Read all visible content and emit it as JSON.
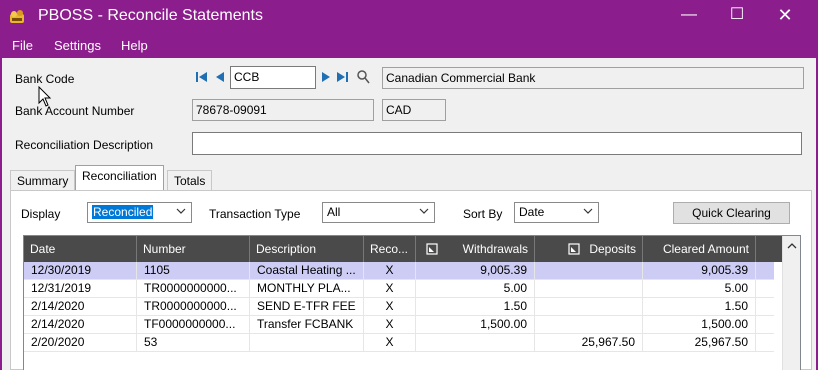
{
  "window": {
    "title": "PBOSS - Reconcile Statements",
    "min": "—",
    "max": "☐",
    "close": "✕"
  },
  "menu": {
    "items": [
      {
        "label": "File"
      },
      {
        "label": "Settings"
      },
      {
        "label": "Help"
      }
    ]
  },
  "form": {
    "bank_code_label": "Bank Code",
    "bank_code_value": "CCB",
    "bank_name": "Canadian Commercial Bank",
    "account_number_label": "Bank Account Number",
    "account_number_value": "78678-09091",
    "currency": "CAD",
    "recon_desc_label": "Reconciliation Description",
    "recon_desc_value": ""
  },
  "tabs": [
    {
      "label": "Summary"
    },
    {
      "label": "Reconciliation"
    },
    {
      "label": "Totals"
    }
  ],
  "filters": {
    "display_label": "Display",
    "display_value": "Reconciled",
    "transaction_type_label": "Transaction Type",
    "transaction_type_value": "All",
    "sort_by_label": "Sort By",
    "sort_by_value": "Date",
    "quick_clearing_label": "Quick Clearing"
  },
  "table": {
    "headers": [
      "Date",
      "Number",
      "Description",
      "Reco...",
      "Withdrawals",
      "Deposits",
      "Cleared Amount"
    ],
    "rows": [
      [
        "12/30/2019",
        "1105",
        "Coastal Heating ...",
        "X",
        "9,005.39",
        "",
        "9,005.39"
      ],
      [
        "12/31/2019",
        "TR0000000000...",
        "MONTHLY PLA...",
        "X",
        "5.00",
        "",
        "5.00"
      ],
      [
        "2/14/2020",
        "TR0000000000...",
        "SEND E-TFR FEE",
        "X",
        "1.50",
        "",
        "1.50"
      ],
      [
        "2/14/2020",
        "TF0000000000...",
        "Transfer FCBANK",
        "X",
        "1,500.00",
        "",
        "1,500.00"
      ],
      [
        "2/20/2020",
        "53",
        "",
        "X",
        "",
        "25,967.50",
        "25,967.50"
      ]
    ],
    "selected_row": 0
  },
  "colors": {
    "accent": "#8c1d8c",
    "header": "#4a4a4a",
    "selection": "#ccccf5"
  },
  "icons": {
    "app": "app-icon",
    "first": "first-record-icon",
    "prev": "previous-record-icon",
    "next": "next-record-icon",
    "last": "last-record-icon",
    "finder": "finder-search-icon"
  }
}
